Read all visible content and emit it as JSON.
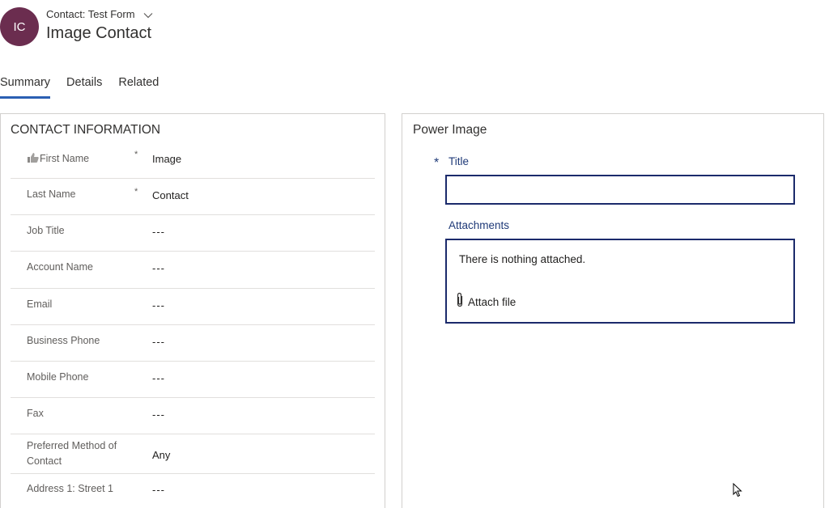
{
  "header": {
    "avatar_initials": "IC",
    "avatar_color": "#6b2d4f",
    "form_selector_label": "Contact: Test Form",
    "record_title": "Image Contact"
  },
  "tabs": [
    {
      "label": "Summary",
      "active": true
    },
    {
      "label": "Details",
      "active": false
    },
    {
      "label": "Related",
      "active": false
    }
  ],
  "contact_section": {
    "title": "CONTACT INFORMATION",
    "fields": [
      {
        "label": "First Name",
        "required": "*",
        "value": "Image",
        "icon": "thumbs-up-icon"
      },
      {
        "label": "Last Name",
        "required": "*",
        "value": "Contact"
      },
      {
        "label": "Job Title",
        "value": "---"
      },
      {
        "label": "Account Name",
        "value": "---"
      },
      {
        "label": "Email",
        "value": "---"
      },
      {
        "label": "Business Phone",
        "value": "---"
      },
      {
        "label": "Mobile Phone",
        "value": "---"
      },
      {
        "label": "Fax",
        "value": "---"
      },
      {
        "label": "Preferred Method of",
        "label2": "Contact",
        "value": "Any"
      },
      {
        "label": "Address 1: Street 1",
        "value": "---"
      }
    ]
  },
  "power_image": {
    "title": "Power Image",
    "required_marker": "*",
    "title_field_label": "Title",
    "title_field_value": "",
    "attachments_label": "Attachments",
    "empty_text": "There is nothing attached.",
    "attach_button_label": "Attach file",
    "accent_color": "#1b2a6b"
  }
}
